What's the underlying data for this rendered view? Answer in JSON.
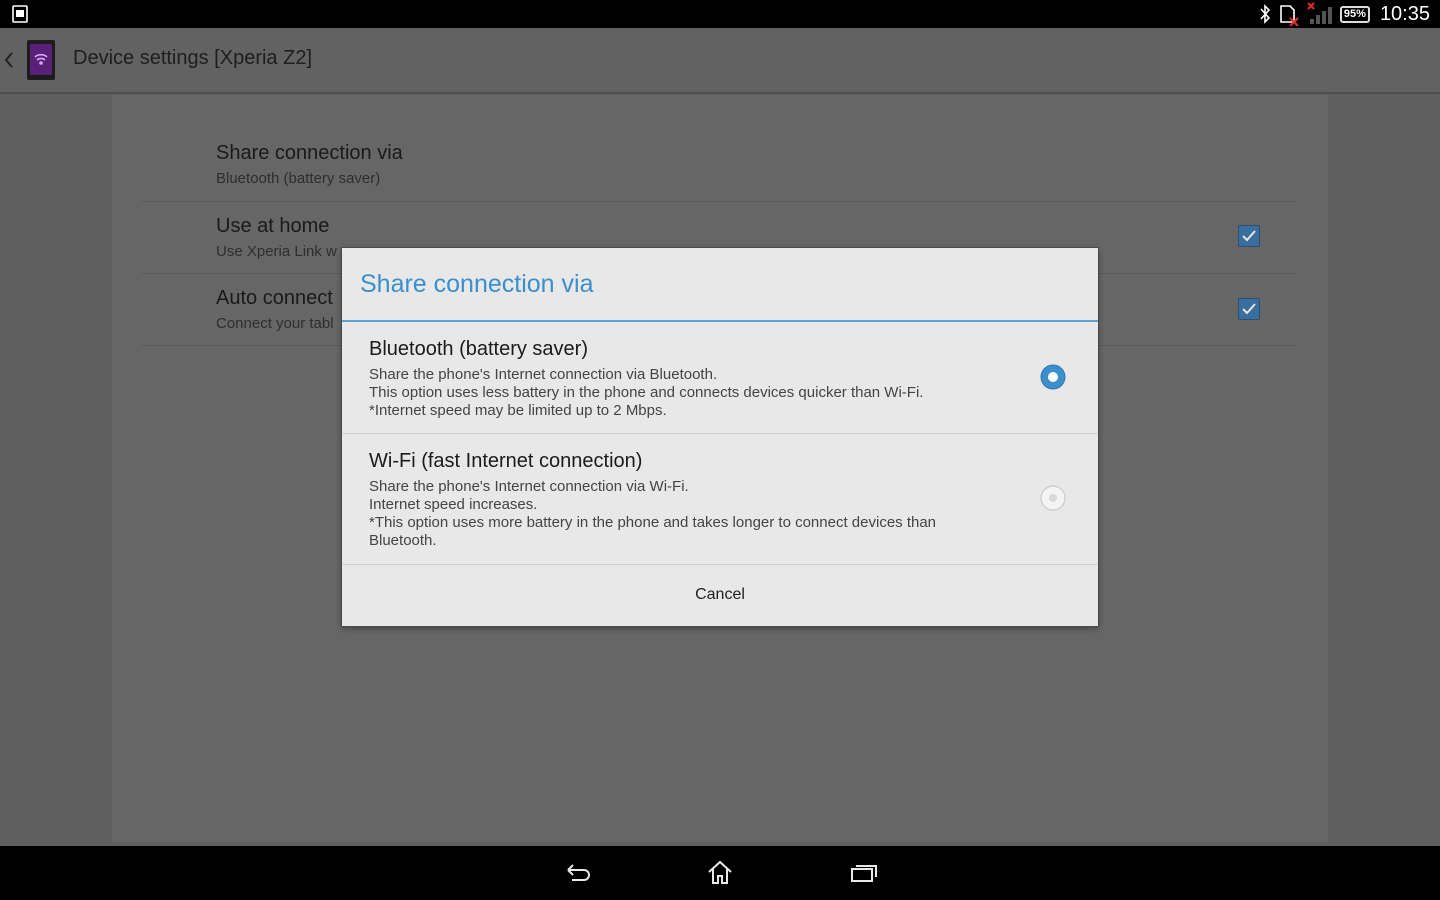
{
  "status_bar": {
    "battery": "95%",
    "clock": "10:35",
    "icons": [
      "screenshot-notification-icon",
      "bluetooth-icon",
      "no-sim-icon",
      "signal-icon",
      "battery-icon"
    ]
  },
  "action_bar": {
    "title": "Device settings [Xperia Z2]",
    "icons": [
      "back-chevron-icon",
      "app-icon"
    ]
  },
  "settings": {
    "items": [
      {
        "title": "Share connection via",
        "summary": "Bluetooth (battery saver)"
      },
      {
        "title": "Use at home",
        "summary": "Use Xperia Link w",
        "checked": true
      },
      {
        "title": "Auto connect",
        "summary": "Connect your tabl",
        "checked": true
      }
    ]
  },
  "dialog": {
    "title": "Share connection via",
    "options": [
      {
        "title": "Bluetooth (battery saver)",
        "lines": [
          "Share the phone's Internet connection via Bluetooth.",
          "This option uses less battery in the phone and connects devices quicker than Wi-Fi.",
          "*Internet speed may be limited up to 2 Mbps."
        ],
        "selected": true
      },
      {
        "title": "Wi-Fi (fast Internet connection)",
        "lines": [
          "Share the phone's Internet connection via Wi-Fi.",
          "Internet speed increases.",
          "*This option uses more battery in the phone and takes longer to connect devices than",
          "Bluetooth."
        ],
        "selected": false
      }
    ],
    "cancel_label": "Cancel"
  },
  "nav_bar": {
    "icons": [
      "back-icon",
      "home-icon",
      "recent-apps-icon"
    ]
  },
  "colors": {
    "accent": "#3b8fcd",
    "checkbox": "#3a6e9e",
    "scrim": "#5f5f5f"
  }
}
